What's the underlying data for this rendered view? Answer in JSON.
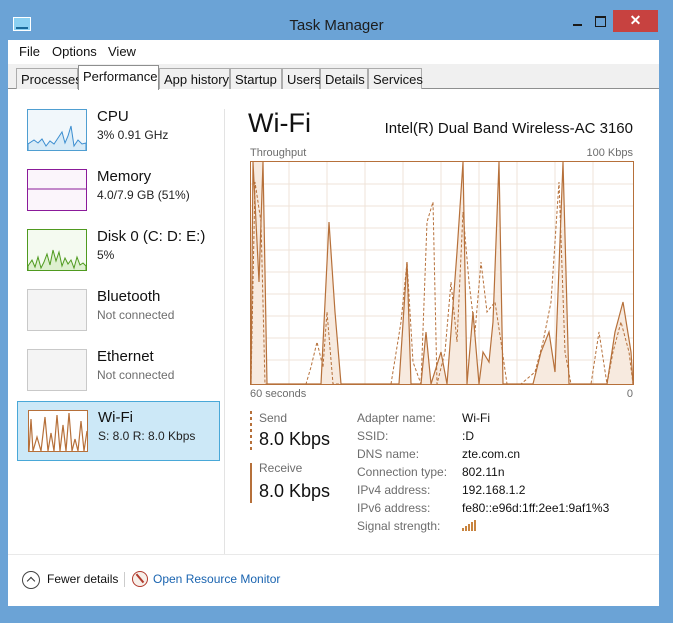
{
  "window": {
    "title": "Task Manager",
    "close_glyph": "✕"
  },
  "menu": [
    "File",
    "Options",
    "View"
  ],
  "tabs": [
    {
      "label": "Processes",
      "active": false
    },
    {
      "label": "Performance",
      "active": true
    },
    {
      "label": "App history",
      "active": false
    },
    {
      "label": "Startup",
      "active": false
    },
    {
      "label": "Users",
      "active": false
    },
    {
      "label": "Details",
      "active": false
    },
    {
      "label": "Services",
      "active": false
    }
  ],
  "sidebar": [
    {
      "name": "CPU",
      "sub": "3% 0.91 GHz"
    },
    {
      "name": "Memory",
      "sub": "4.0/7.9 GB (51%)"
    },
    {
      "name": "Disk 0 (C: D: E:)",
      "sub": "5%"
    },
    {
      "name": "Bluetooth",
      "sub": "Not connected"
    },
    {
      "name": "Ethernet",
      "sub": "Not connected"
    },
    {
      "name": "Wi-Fi",
      "sub": "S: 8.0  R: 8.0 Kbps"
    }
  ],
  "detail": {
    "title": "Wi-Fi",
    "adapter": "Intel(R) Dual Band Wireless-AC 3160",
    "graph_label": "Throughput",
    "graph_max": "100 Kbps",
    "x_left": "60 seconds",
    "x_right": "0",
    "send_label": "Send",
    "send_value": "8.0 Kbps",
    "receive_label": "Receive",
    "receive_value": "8.0 Kbps",
    "properties": [
      {
        "label": "Adapter name:",
        "value": "Wi-Fi"
      },
      {
        "label": "SSID:",
        "value": ":D"
      },
      {
        "label": "DNS name:",
        "value": "zte.com.cn"
      },
      {
        "label": "Connection type:",
        "value": "802.11n"
      },
      {
        "label": "IPv4 address:",
        "value": "192.168.1.2"
      },
      {
        "label": "IPv6 address:",
        "value": "fe80::e96d:1ff:2ee1:9af1%3"
      },
      {
        "label": "Signal strength:",
        "value": ""
      }
    ]
  },
  "footer": {
    "fewer": "Fewer details",
    "monitor": "Open Resource Monitor"
  },
  "colors": {
    "accent": "#b6703a",
    "selection": "#cce8f7",
    "link": "#1a64b0"
  }
}
